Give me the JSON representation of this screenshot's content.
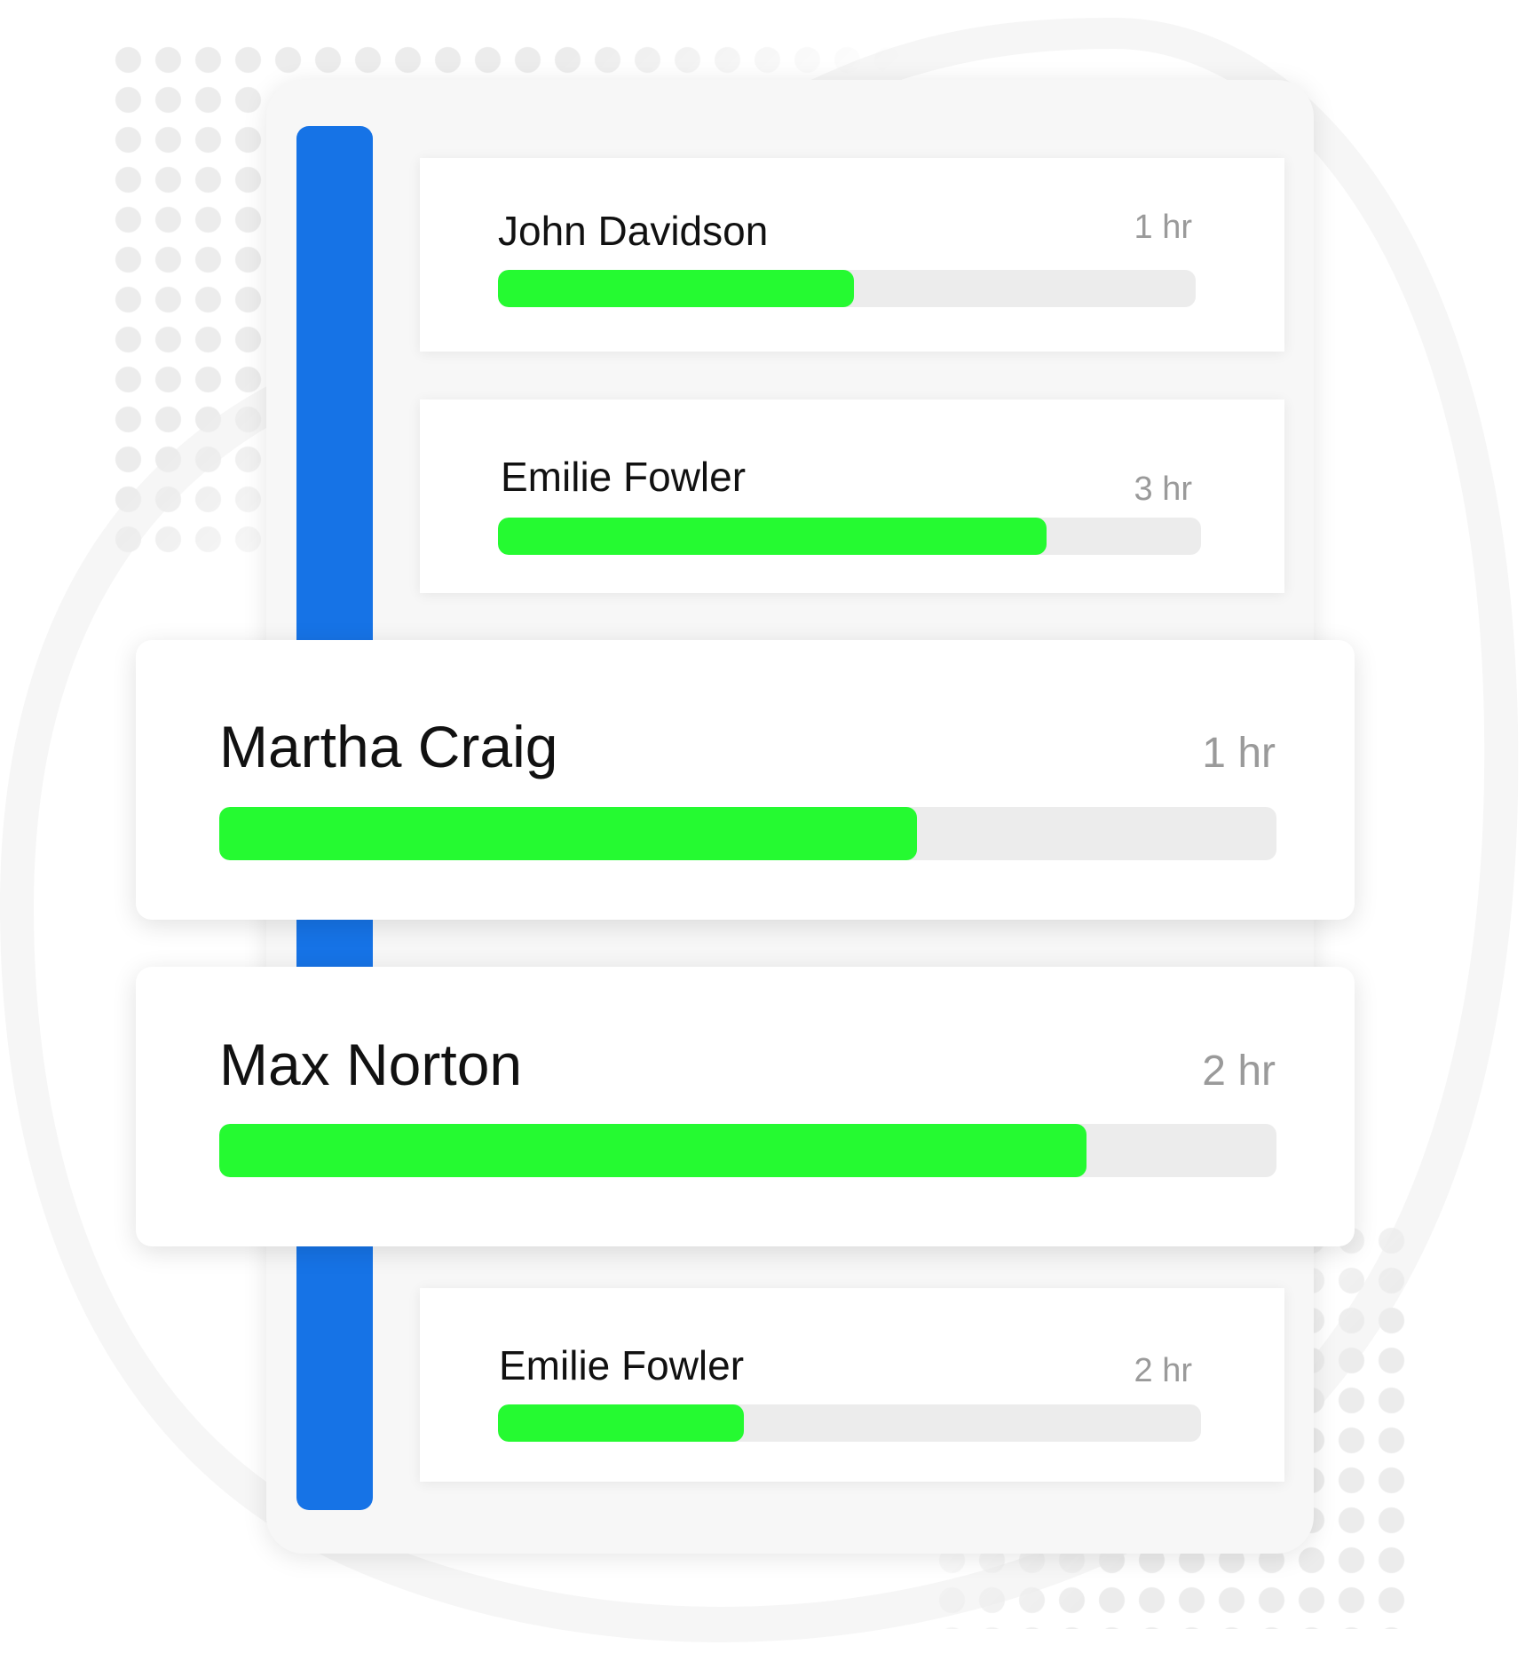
{
  "colors": {
    "accent_blue": "#1673e6",
    "progress_fill": "#25fa31",
    "progress_track": "#ececec",
    "duration_text": "#9a9a9a",
    "name_text": "#111111"
  },
  "entries": [
    {
      "name": "John Davidson",
      "duration": "1 hr",
      "progress": 0.51
    },
    {
      "name": "Emilie Fowler",
      "duration": "3 hr",
      "progress": 0.78
    },
    {
      "name": "Martha Craig",
      "duration": "1 hr",
      "progress": 0.66
    },
    {
      "name": "Max Norton",
      "duration": "2 hr",
      "progress": 0.82
    },
    {
      "name": "Emilie Fowler",
      "duration": "2 hr",
      "progress": 0.35
    }
  ]
}
